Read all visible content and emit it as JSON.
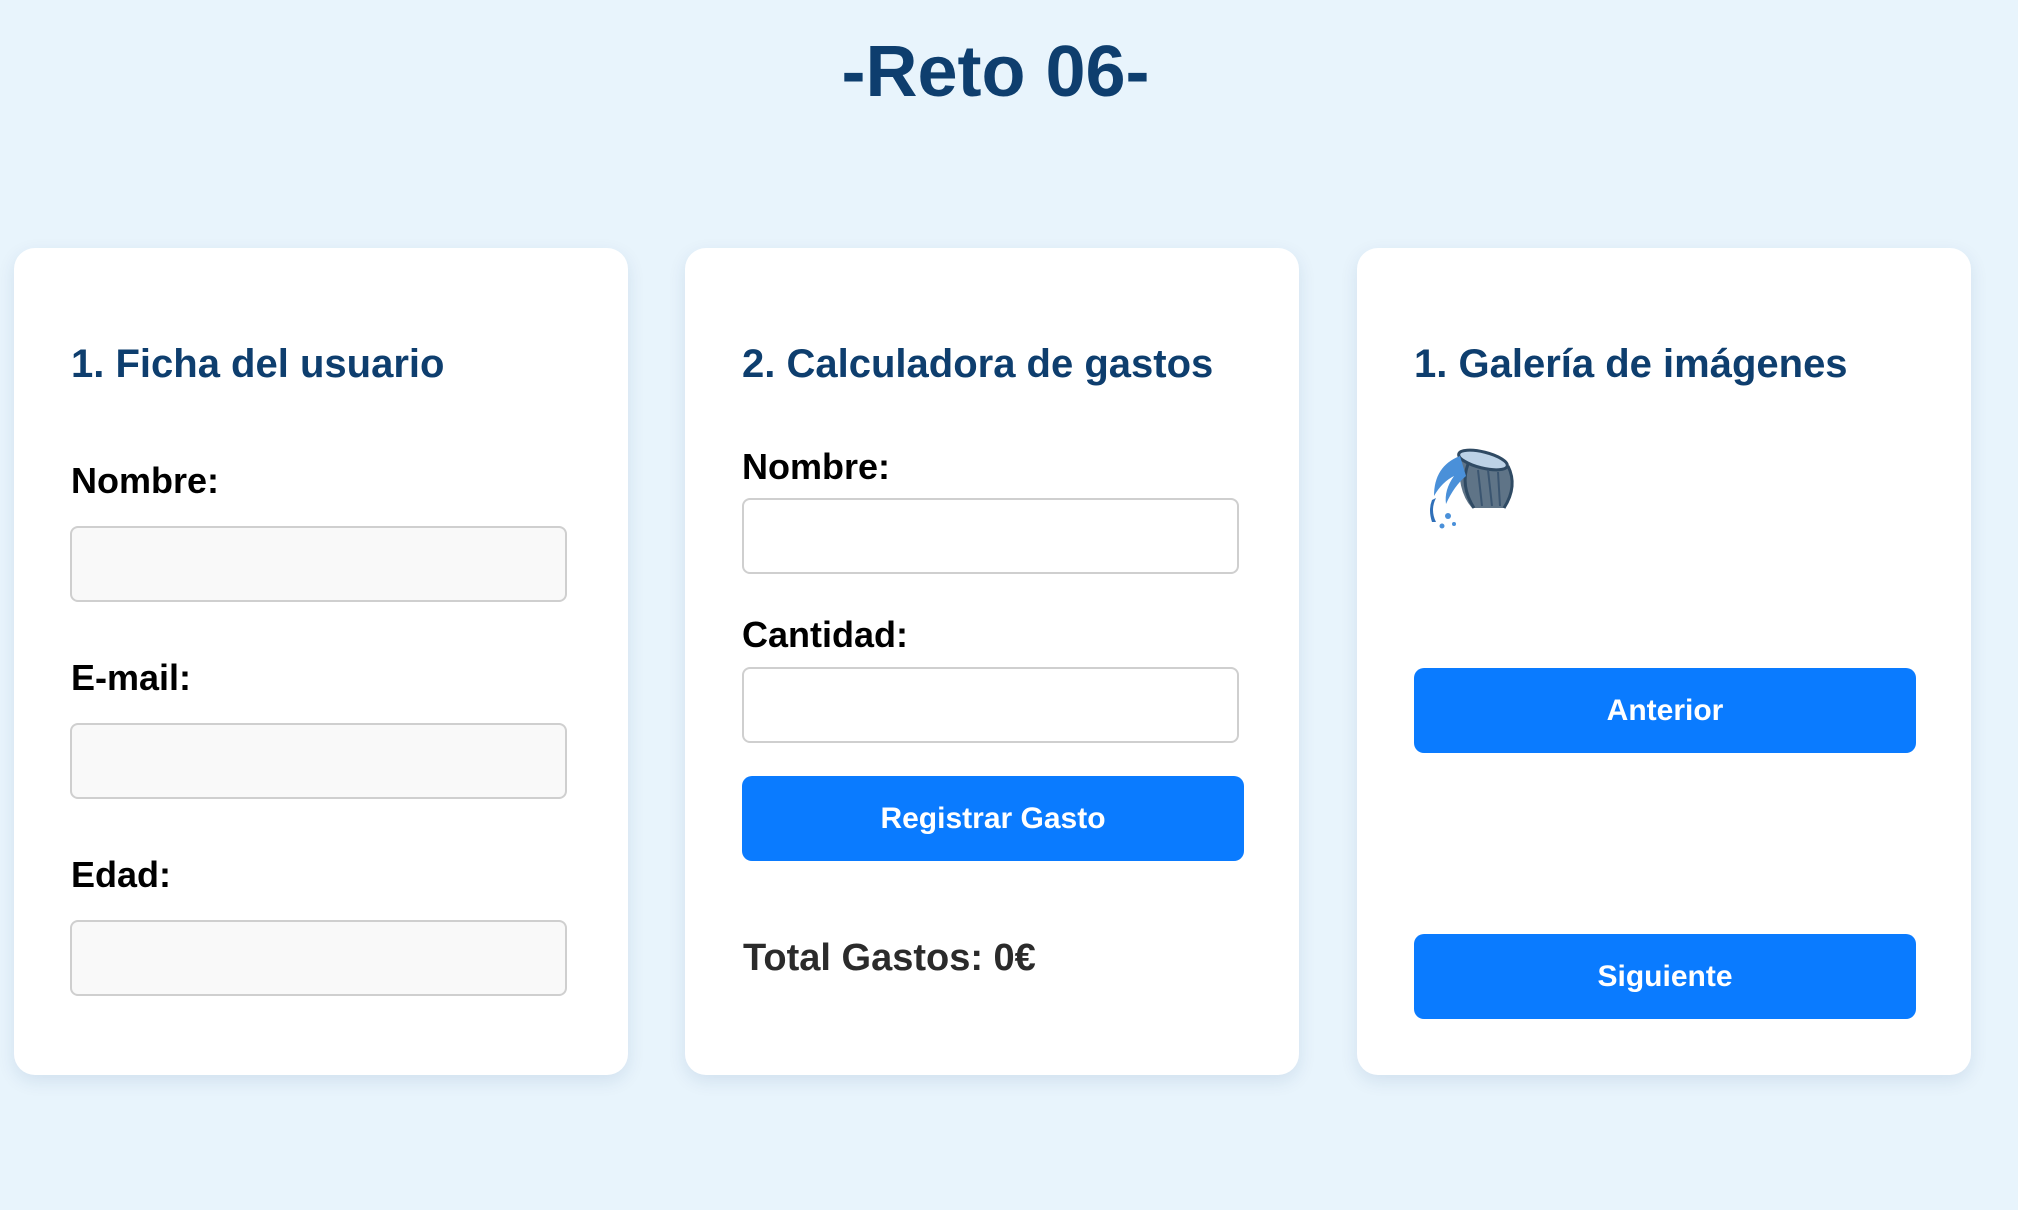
{
  "title": "-Reto 06-",
  "colors": {
    "background": "#e8f4fc",
    "heading": "#0e3e6e",
    "button": "#0a7bff"
  },
  "user_card": {
    "heading": "1. Ficha del usuario",
    "name_label": "Nombre:",
    "email_label": "E-mail:",
    "age_label": "Edad:"
  },
  "expense_card": {
    "heading": "2. Calculadora de gastos",
    "name_label": "Nombre:",
    "amount_label": "Cantidad:",
    "register_button": "Registrar Gasto",
    "total_text": "Total Gastos: 0€"
  },
  "gallery_card": {
    "heading": "1. Galería de imágenes",
    "image_icon": "water-bucket-icon",
    "prev_button": "Anterior",
    "next_button": "Siguiente"
  }
}
